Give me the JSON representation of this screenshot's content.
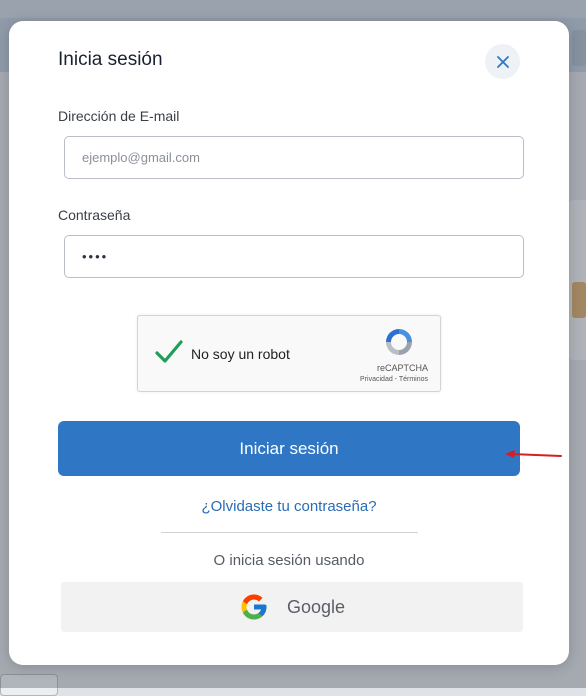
{
  "modal": {
    "title": "Inicia sesión",
    "close_icon": "close-icon"
  },
  "email": {
    "label": "Dirección de E-mail",
    "placeholder": "ejemplo@gmail.com",
    "value": ""
  },
  "password": {
    "label": "Contraseña",
    "value": "••••"
  },
  "captcha": {
    "label": "No soy un robot",
    "brand": "reCAPTCHA",
    "links": "Privacidad - Términos",
    "checked": true
  },
  "actions": {
    "submit_label": "Iniciar sesión",
    "forgot_label": "¿Olvidaste tu contraseña?",
    "alt_label": "O inicia sesión usando",
    "google_label": "Google"
  },
  "colors": {
    "primary": "#2f77c4",
    "link": "#2a6cb5",
    "annotation_arrow": "#d42020"
  }
}
